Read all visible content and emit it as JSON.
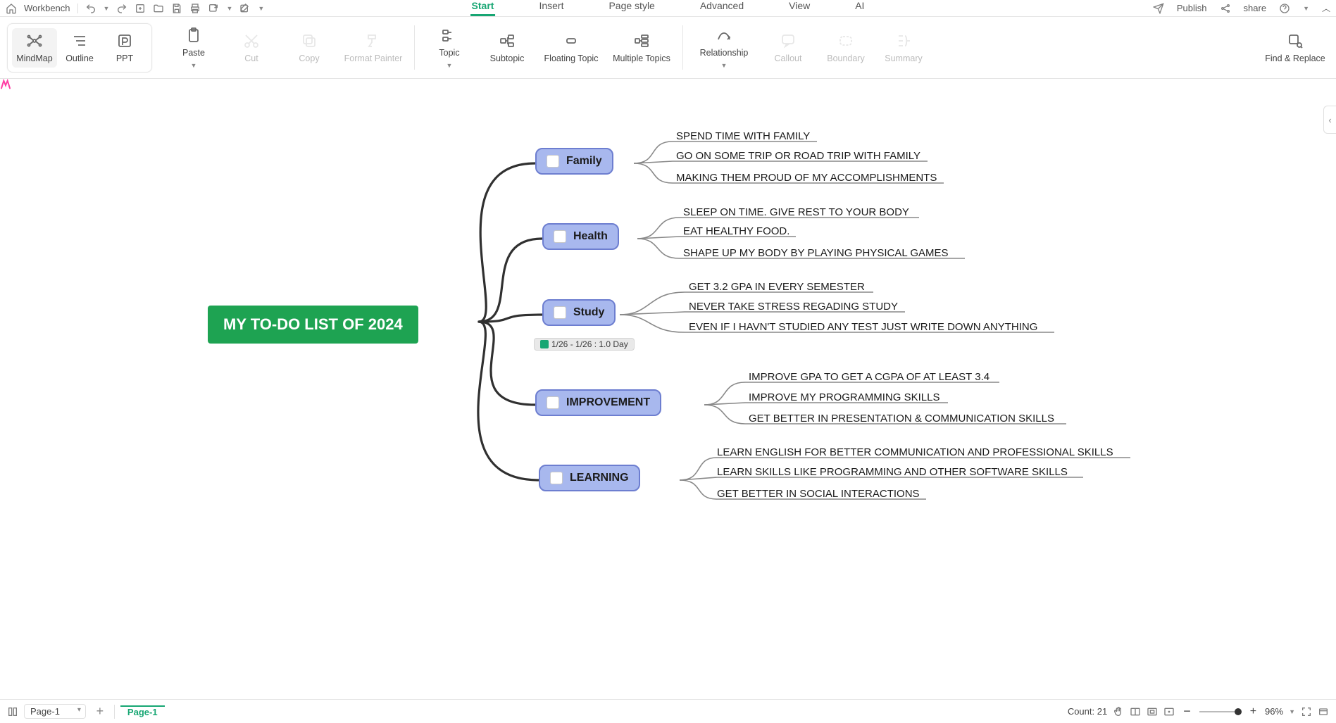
{
  "quickbar": {
    "workbench": "Workbench"
  },
  "menutabs": [
    "Start",
    "Insert",
    "Page style",
    "Advanced",
    "View",
    "AI"
  ],
  "quickright": {
    "publish": "Publish",
    "share": "share"
  },
  "views": {
    "mindmap": "MindMap",
    "outline": "Outline",
    "ppt": "PPT"
  },
  "ribbon": {
    "paste": "Paste",
    "cut": "Cut",
    "copy": "Copy",
    "format": "Format Painter",
    "topic": "Topic",
    "subtopic": "Subtopic",
    "floating": "Floating Topic",
    "multiple": "Multiple Topics",
    "relationship": "Relationship",
    "callout": "Callout",
    "boundary": "Boundary",
    "summary": "Summary",
    "find": "Find & Replace"
  },
  "mind": {
    "root": "MY TO-DO LIST OF 2024",
    "branches": [
      {
        "label": "Family",
        "items": [
          "SPEND TIME WITH FAMILY",
          "GO ON SOME TRIP OR ROAD TRIP WITH FAMILY",
          "MAKING THEM PROUD OF MY ACCOMPLISHMENTS"
        ]
      },
      {
        "label": "Health",
        "items": [
          "SLEEP ON TIME. GIVE REST TO YOUR BODY",
          "EAT HEALTHY FOOD.",
          "SHAPE UP MY BODY BY PLAYING PHYSICAL GAMES"
        ]
      },
      {
        "label": "Study",
        "tag": "1/26 - 1/26 : 1.0 Day",
        "items": [
          "GET 3.2 GPA IN EVERY SEMESTER",
          "NEVER TAKE STRESS REGADING STUDY",
          "EVEN IF I HAVN'T STUDIED ANY TEST JUST WRITE DOWN ANYTHING"
        ]
      },
      {
        "label": "IMPROVEMENT",
        "items": [
          "IMPROVE GPA TO GET A CGPA OF AT LEAST 3.4",
          "IMPROVE MY PROGRAMMING SKILLS",
          "GET BETTER IN PRESENTATION & COMMUNICATION SKILLS"
        ]
      },
      {
        "label": "LEARNING",
        "items": [
          "LEARN ENGLISH FOR BETTER COMMUNICATION AND PROFESSIONAL SKILLS",
          "LEARN SKILLS LIKE PROGRAMMING AND OTHER SOFTWARE SKILLS",
          "GET BETTER IN SOCIAL INTERACTIONS"
        ]
      }
    ]
  },
  "status": {
    "page": "Page-1",
    "tab": "Page-1",
    "count": "Count: 21",
    "zoom": "96%"
  }
}
